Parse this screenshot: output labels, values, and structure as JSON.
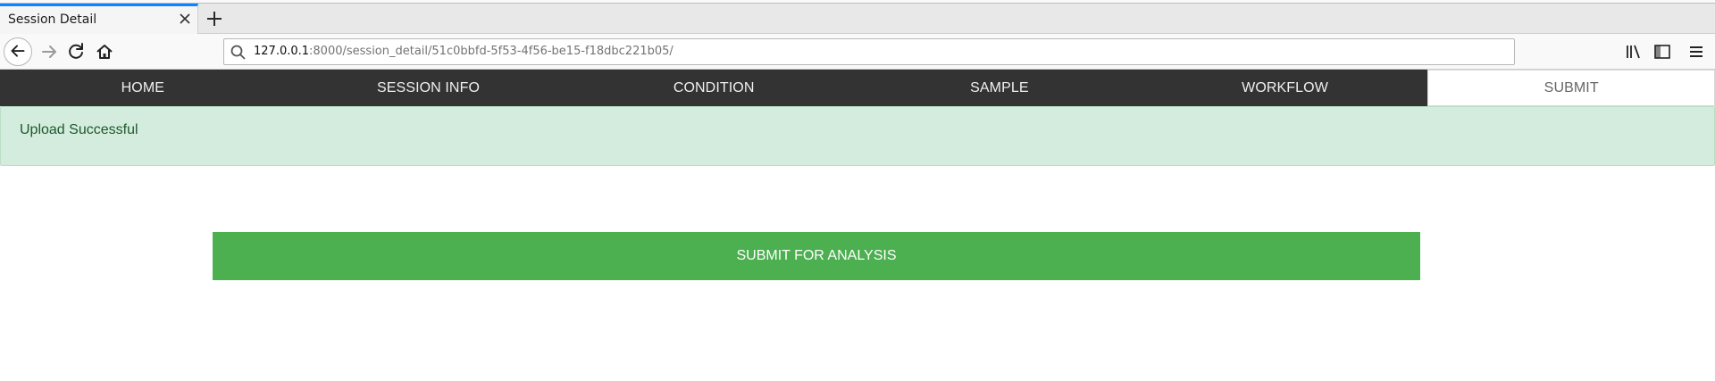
{
  "browser": {
    "tab_title": "Session Detail",
    "url_host": "127.0.0.1",
    "url_rest": ":8000/session_detail/51c0bbfd-5f53-4f56-be15-f18dbc221b05/"
  },
  "nav": {
    "tabs": [
      {
        "label": "HOME"
      },
      {
        "label": "SESSION INFO"
      },
      {
        "label": "CONDITION"
      },
      {
        "label": "SAMPLE"
      },
      {
        "label": "WORKFLOW"
      },
      {
        "label": "SUBMIT"
      }
    ],
    "active_index": 5
  },
  "alert": {
    "message": "Upload Successful"
  },
  "submit": {
    "label": "SUBMIT FOR ANALYSIS"
  },
  "colors": {
    "nav_bg": "#333333",
    "alert_bg": "#d4ecdd",
    "alert_text": "#1d5a2c",
    "submit_bg": "#4caf50",
    "tab_accent": "#0a84ff"
  },
  "icons": {
    "tab_close": "close-icon",
    "new_tab": "plus-icon",
    "back": "arrow-left-icon",
    "forward": "arrow-right-icon",
    "reload": "reload-icon",
    "home": "home-icon",
    "url_search": "search-icon",
    "library": "library-icon",
    "sidebar": "sidebar-icon",
    "menu": "hamburger-menu-icon"
  }
}
